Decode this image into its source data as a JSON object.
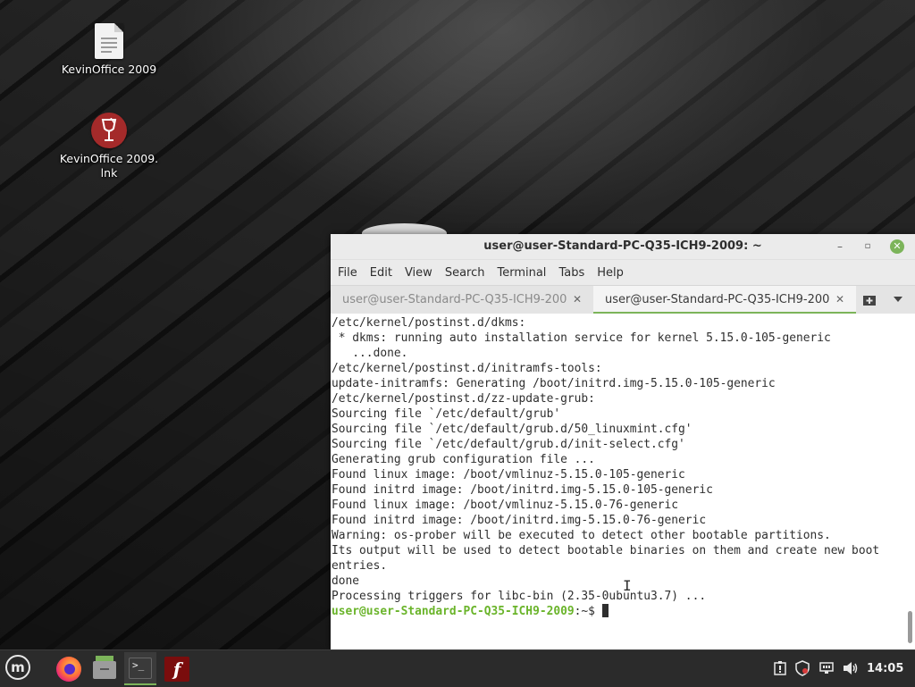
{
  "desktop": {
    "icons": [
      {
        "label": "KevinOffice 2009",
        "icon": "document-icon"
      },
      {
        "label": "KevinOffice 2009.\nlnk",
        "icon": "wine-glass-icon"
      }
    ]
  },
  "terminal": {
    "title": "user@user-Standard-PC-Q35-ICH9-2009: ~",
    "window_buttons": {
      "minimize": "–",
      "maximize": "▫",
      "close": "✕"
    },
    "menu": [
      "File",
      "Edit",
      "View",
      "Search",
      "Terminal",
      "Tabs",
      "Help"
    ],
    "tabs": [
      {
        "label": "user@user-Standard-PC-Q35-ICH9-200…",
        "close": "✕",
        "active": false
      },
      {
        "label": "user@user-Standard-PC-Q35-ICH9-200…",
        "close": "✕",
        "active": true
      }
    ],
    "accent_color": "#7cb45a",
    "lines": [
      "/etc/kernel/postinst.d/dkms:",
      " * dkms: running auto installation service for kernel 5.15.0-105-generic",
      "   ...done.",
      "/etc/kernel/postinst.d/initramfs-tools:",
      "update-initramfs: Generating /boot/initrd.img-5.15.0-105-generic",
      "/etc/kernel/postinst.d/zz-update-grub:",
      "Sourcing file `/etc/default/grub'",
      "Sourcing file `/etc/default/grub.d/50_linuxmint.cfg'",
      "Sourcing file `/etc/default/grub.d/init-select.cfg'",
      "Generating grub configuration file ...",
      "Found linux image: /boot/vmlinuz-5.15.0-105-generic",
      "Found initrd image: /boot/initrd.img-5.15.0-105-generic",
      "Found linux image: /boot/vmlinuz-5.15.0-76-generic",
      "Found initrd image: /boot/initrd.img-5.15.0-76-generic",
      "Warning: os-prober will be executed to detect other bootable partitions.",
      "Its output will be used to detect bootable binaries on them and create new boot",
      "entries.",
      "done",
      "Processing triggers for libc-bin (2.35-0ubuntu3.7) ..."
    ],
    "prompt": {
      "user_host": "user@user-Standard-PC-Q35-ICH9-2009",
      "path": ":~$ "
    },
    "prompt_color": "#6ab42a"
  },
  "taskbar": {
    "apps": [
      "mint-menu-icon",
      "firefox-icon",
      "files-icon",
      "terminal-icon",
      "flash-icon"
    ],
    "clock": "14:05"
  }
}
